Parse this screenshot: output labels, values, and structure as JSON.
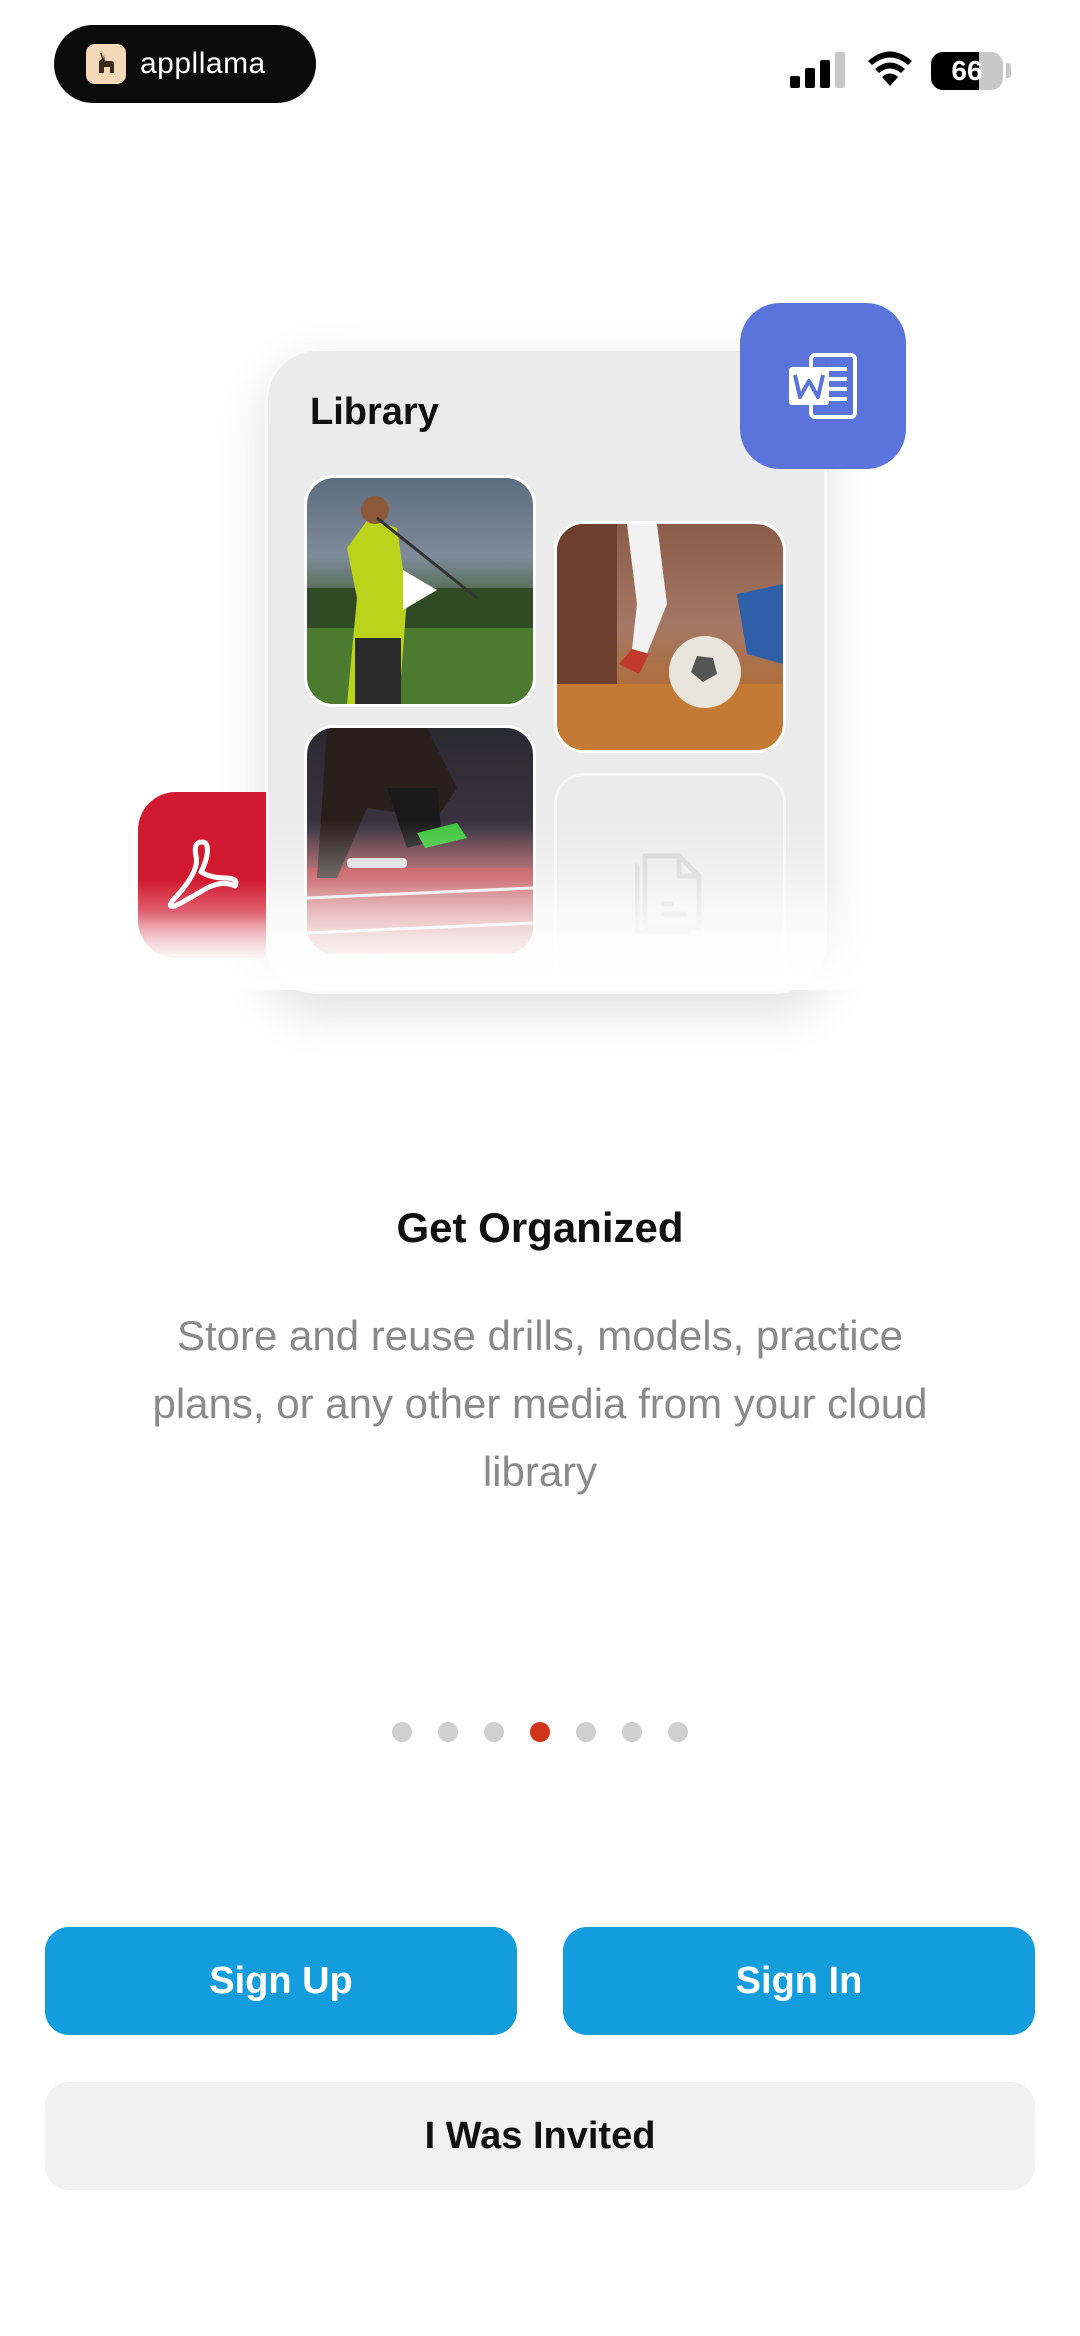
{
  "status_bar": {
    "app_badge": "appllama",
    "battery": "66",
    "battery_level": 0.66
  },
  "illustration": {
    "library_title": "Library",
    "thumbnails": [
      "golf-video",
      "soccer-photo",
      "track-photo",
      "document"
    ],
    "floating_icons": [
      "word-icon",
      "pdf-icon"
    ]
  },
  "onboarding": {
    "title": "Get Organized",
    "description": "Store and reuse drills, models, practice plans, or any other media from your cloud library",
    "page_count": 7,
    "active_page": 4,
    "active_dot_color": "#d0341a"
  },
  "actions": {
    "sign_up": "Sign Up",
    "sign_in": "Sign In",
    "invited": "I Was Invited"
  },
  "colors": {
    "primary_button": "#149ddd",
    "word_tile": "#5b74dc",
    "pdf_tile": "#d11a2f"
  }
}
